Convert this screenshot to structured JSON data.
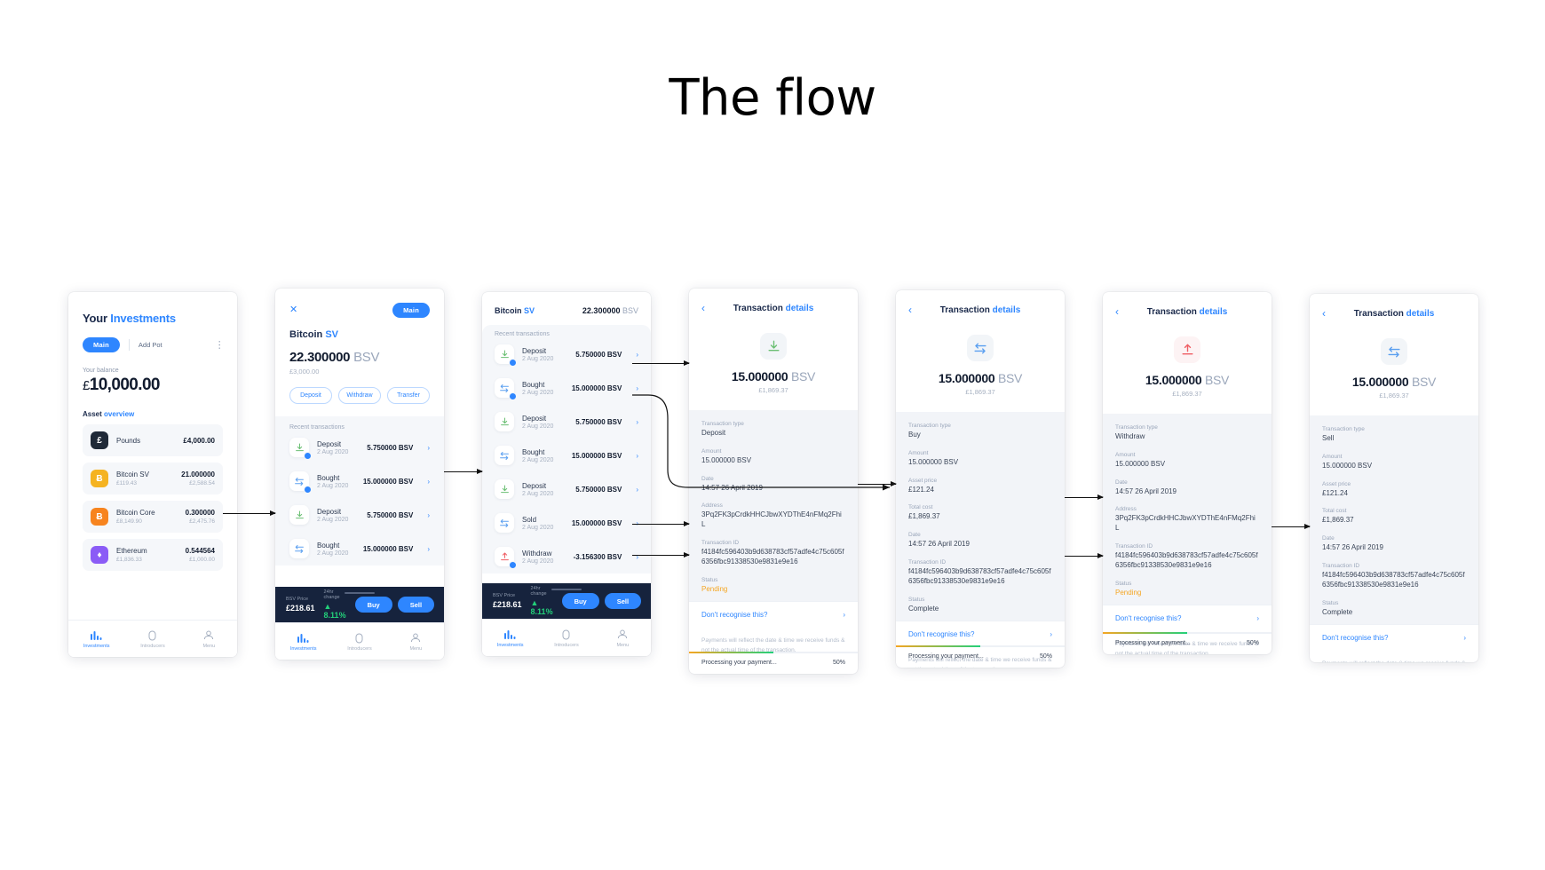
{
  "page": {
    "title": "The flow"
  },
  "colors": {
    "accent": "#2e86ff",
    "dark": "#16233d",
    "green": "#23d07a",
    "orange": "#f5a623",
    "red": "#ef5d63",
    "pounds_icon_bg": "#1f2937",
    "bsv_icon_bg": "#f5b321",
    "btc_icon_bg": "#f7841f",
    "eth_icon_bg": "#8b5cf6"
  },
  "tabbar": {
    "items": [
      {
        "label": "Investments",
        "icon": "bar-chart-icon",
        "active": true
      },
      {
        "label": "Introducers",
        "icon": "contact-icon",
        "active": false
      },
      {
        "label": "Menu",
        "icon": "person-icon",
        "active": false
      }
    ]
  },
  "panel1": {
    "title_lead": "Your",
    "title_accent": "Investments",
    "pill_label": "Main",
    "add_pot_label": "Add Pot",
    "menu_icon": "kebab-menu-icon",
    "balance_label": "Your balance",
    "balance_currency": "£",
    "balance_value": "10,000.00",
    "section_lead": "Asset",
    "section_accent": "overview",
    "assets": [
      {
        "symbol": "£",
        "name": "Pounds",
        "price": "",
        "amount": "£4,000.00",
        "gbp": ""
      },
      {
        "symbol": "Ƀ",
        "name": "Bitcoin SV",
        "price": "£119.43",
        "amount": "21.000000",
        "gbp": "£2,588.54"
      },
      {
        "symbol": "Ƀ",
        "name": "Bitcoin Core",
        "price": "£8,149.90",
        "amount": "0.300000",
        "gbp": "£2,475.76"
      },
      {
        "symbol": "♦",
        "name": "Ethereum",
        "price": "£1,836.33",
        "amount": "0.544564",
        "gbp": "£1,000.00"
      }
    ]
  },
  "panel2": {
    "close_icon": "close-icon",
    "pill_label": "Main",
    "title_lead": "Bitcoin",
    "title_accent": "SV",
    "amount": "22.300000",
    "amount_unit": "BSV",
    "fiat": "£3,000.00",
    "actions": [
      "Deposit",
      "Withdraw",
      "Transfer"
    ],
    "tx_header": "Recent transactions",
    "transactions": [
      {
        "type": "Deposit",
        "icon": "deposit-icon",
        "date": "2 Aug 2020",
        "amount": "5.750000 BSV",
        "badge": true
      },
      {
        "type": "Bought",
        "icon": "exchange-icon",
        "date": "2 Aug 2020",
        "amount": "15.000000 BSV",
        "badge": true
      },
      {
        "type": "Deposit",
        "icon": "deposit-icon",
        "date": "2 Aug 2020",
        "amount": "5.750000 BSV",
        "badge": false
      },
      {
        "type": "Bought",
        "icon": "exchange-icon",
        "date": "2 Aug 2020",
        "amount": "15.000000 BSV",
        "badge": false
      }
    ],
    "price_bar": {
      "price_label": "BSV Price",
      "price_value": "£218.61",
      "change_label": "24hr change",
      "change_value": "▲ 8.11%",
      "buy_label": "Buy",
      "sell_label": "Sell"
    }
  },
  "panel3": {
    "header_lead": "Bitcoin",
    "header_accent": "SV",
    "header_amount": "22.300000",
    "header_unit": "BSV",
    "tx_header": "Recent transactions",
    "transactions": [
      {
        "type": "Deposit",
        "icon": "deposit-icon",
        "date": "2 Aug 2020",
        "amount": "5.750000 BSV",
        "badge": true
      },
      {
        "type": "Bought",
        "icon": "exchange-icon",
        "date": "2 Aug 2020",
        "amount": "15.000000 BSV",
        "badge": true
      },
      {
        "type": "Deposit",
        "icon": "deposit-icon",
        "date": "2 Aug 2020",
        "amount": "5.750000 BSV",
        "badge": false
      },
      {
        "type": "Bought",
        "icon": "exchange-icon",
        "date": "2 Aug 2020",
        "amount": "15.000000 BSV",
        "badge": false
      },
      {
        "type": "Deposit",
        "icon": "deposit-icon",
        "date": "2 Aug 2020",
        "amount": "5.750000 BSV",
        "badge": false
      },
      {
        "type": "Sold",
        "icon": "exchange-icon",
        "date": "2 Aug 2020",
        "amount": "15.000000 BSV",
        "badge": false
      },
      {
        "type": "Withdraw",
        "icon": "withdraw-icon",
        "date": "2 Aug 2020",
        "amount": "-3.156300 BSV",
        "badge": true
      }
    ],
    "price_bar": {
      "price_label": "BSV Price",
      "price_value": "£218.61",
      "change_label": "24hr change",
      "change_value": "▲ 8.11%",
      "buy_label": "Buy",
      "sell_label": "Sell"
    }
  },
  "details_common": {
    "back_icon": "chevron-left-icon",
    "title_lead": "Transaction",
    "title_accent": "details",
    "amount": "15.000000",
    "amount_unit": "BSV",
    "fiat": "£1,869.37",
    "link_label": "Don't recognise this?",
    "link_chevron": "chevron-right-icon",
    "note": "Payments will reflect the date & time we receive funds & not the actual time of the transaction.",
    "progress_label": "Processing your payment...",
    "progress_percent": "50%",
    "progress_value": 50,
    "labels": {
      "transaction_type": "Transaction type",
      "amount": "Amount",
      "asset_price": "Asset price",
      "total_cost": "Total cost",
      "date": "Date",
      "address": "Address",
      "transaction_id": "Transaction ID",
      "status": "Status"
    }
  },
  "panel4": {
    "icon": "deposit-icon",
    "icon_color": "#6bbf73",
    "icon_bg": "#f2f5f8",
    "transaction_type": "Deposit",
    "amount": "15.000000 BSV",
    "date": "14:57 26 April 2019",
    "address": "3Pq2FK3pCrdkHHCJbwXYDThE4nFMq2FhiL",
    "transaction_id": "f4184fc596403b9d638783cf57adfe4c75c605f6356fbc91338530e9831e9e16",
    "status": "Pending",
    "status_pending": true
  },
  "panel5": {
    "icon": "exchange-icon",
    "icon_color": "#5a9ff0",
    "icon_bg": "#f2f5f8",
    "transaction_type": "Buy",
    "amount": "15.000000 BSV",
    "asset_price": "£121.24",
    "total_cost": "£1,869.37",
    "date": "14:57 26 April 2019",
    "transaction_id": "f4184fc596403b9d638783cf57adfe4c75c605f6356fbc91338530e9831e9e16",
    "status": "Complete",
    "status_pending": false
  },
  "panel6": {
    "icon": "withdraw-icon",
    "icon_color": "#ef5d63",
    "icon_bg": "#fdf3f4",
    "transaction_type": "Withdraw",
    "amount": "15.000000 BSV",
    "date": "14:57 26 April 2019",
    "address": "3Pq2FK3pCrdkHHCJbwXYDThE4nFMq2FhiL",
    "transaction_id": "f4184fc596403b9d638783cf57adfe4c75c605f6356fbc91338530e9831e9e16",
    "status": "Pending",
    "status_pending": true
  },
  "panel7": {
    "icon": "exchange-icon",
    "icon_color": "#5a9ff0",
    "icon_bg": "#f2f5f8",
    "transaction_type": "Sell",
    "amount": "15.000000 BSV",
    "asset_price": "£121.24",
    "total_cost": "£1,869.37",
    "date": "14:57 26 April 2019",
    "transaction_id": "f4184fc596403b9d638783cf57adfe4c75c605f6356fbc91338530e9831e9e16",
    "status": "Complete",
    "status_pending": false
  }
}
